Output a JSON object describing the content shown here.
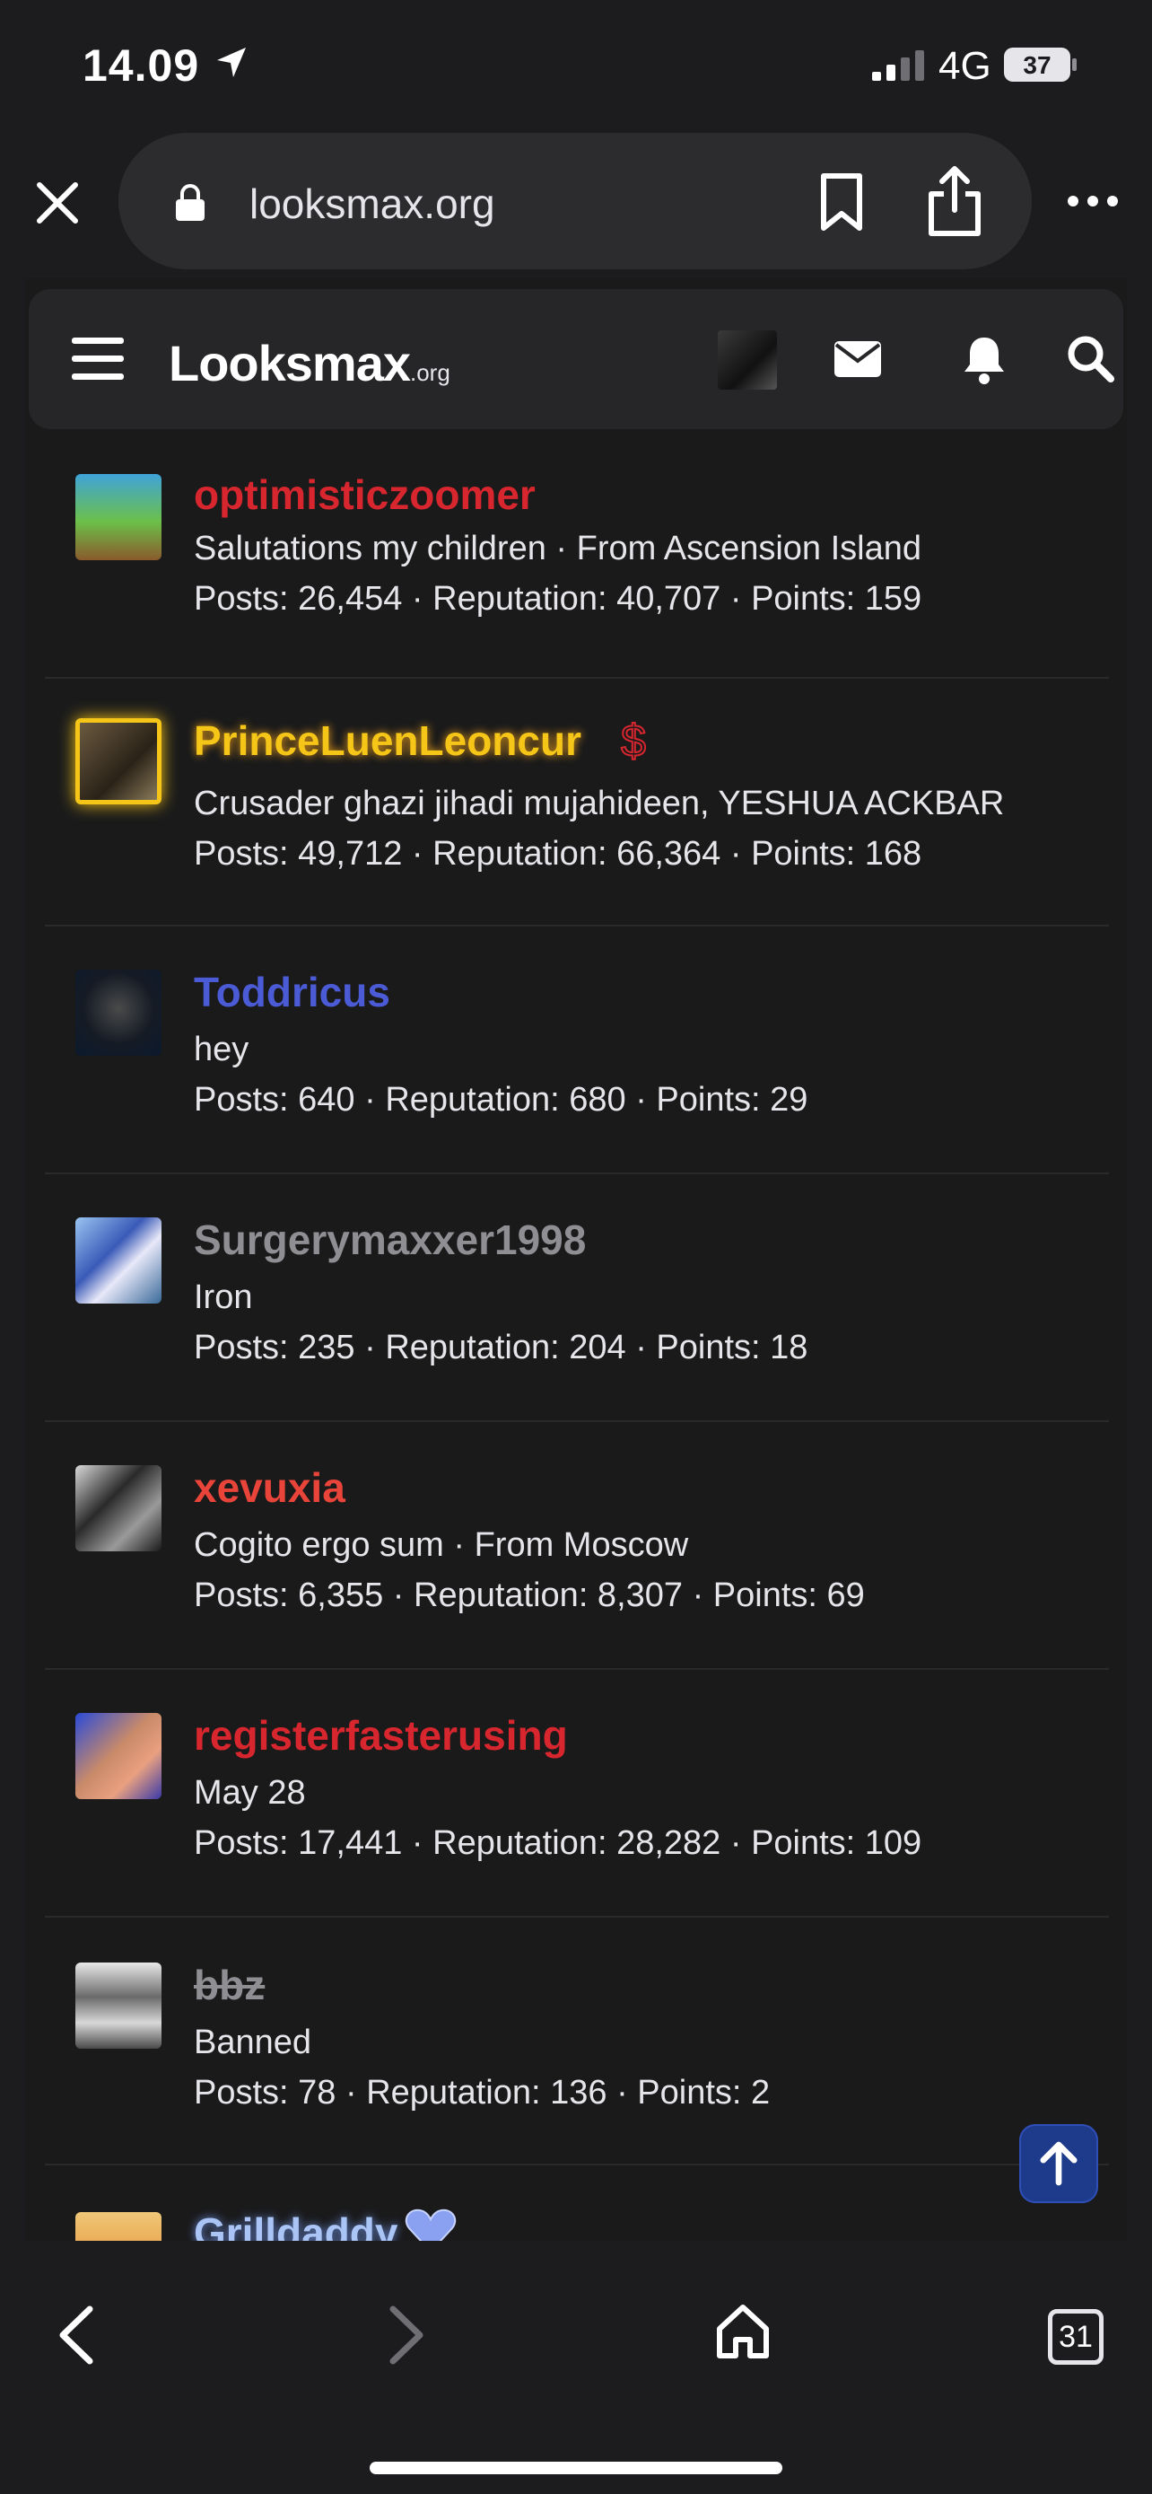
{
  "status_bar": {
    "time": "14.09",
    "network": "4G",
    "battery": "37"
  },
  "browser": {
    "url": "looksmax.org",
    "tab_count": "31"
  },
  "site": {
    "logo_main": "Looksmax",
    "logo_suffix": ".org"
  },
  "colors": {
    "red": "#d8262f",
    "gold": "#f5c518",
    "blue": "#4b5bd6",
    "gray": "#8e8e93",
    "lightblue": "#a9c4f5"
  },
  "members": [
    {
      "name": "optimisticzoomer",
      "line1": "Salutations my children · From Ascension Island",
      "line2": "Posts: 26,454 · Reputation: 40,707 · Points: 159"
    },
    {
      "name": "PrinceLuenLeoncur",
      "line1": "Crusader ghazi jihadi mujahideen, YESHUA ACKBAR",
      "line2": "Posts: 49,712 · Reputation: 66,364 · Points: 168"
    },
    {
      "name": "Toddricus",
      "line1": "hey",
      "line2": "Posts: 640 · Reputation: 680 · Points: 29"
    },
    {
      "name": "Surgerymaxxer1998",
      "line1": "Iron",
      "line2": "Posts: 235 · Reputation: 204 · Points: 18"
    },
    {
      "name": "xevuxia",
      "line1": "Cogito ergo sum · From Moscow",
      "line2": "Posts: 6,355 · Reputation: 8,307 · Points: 69"
    },
    {
      "name": "registerfasterusing",
      "line1": "May 28",
      "line2": "Posts: 17,441 · Reputation: 28,282 · Points: 109"
    },
    {
      "name": "bbz",
      "line1": "Banned",
      "line2": "Posts: 78 · Reputation: 136 · Points: 2"
    },
    {
      "name": "Grilldaddy",
      "line1": "",
      "line2": ""
    }
  ]
}
